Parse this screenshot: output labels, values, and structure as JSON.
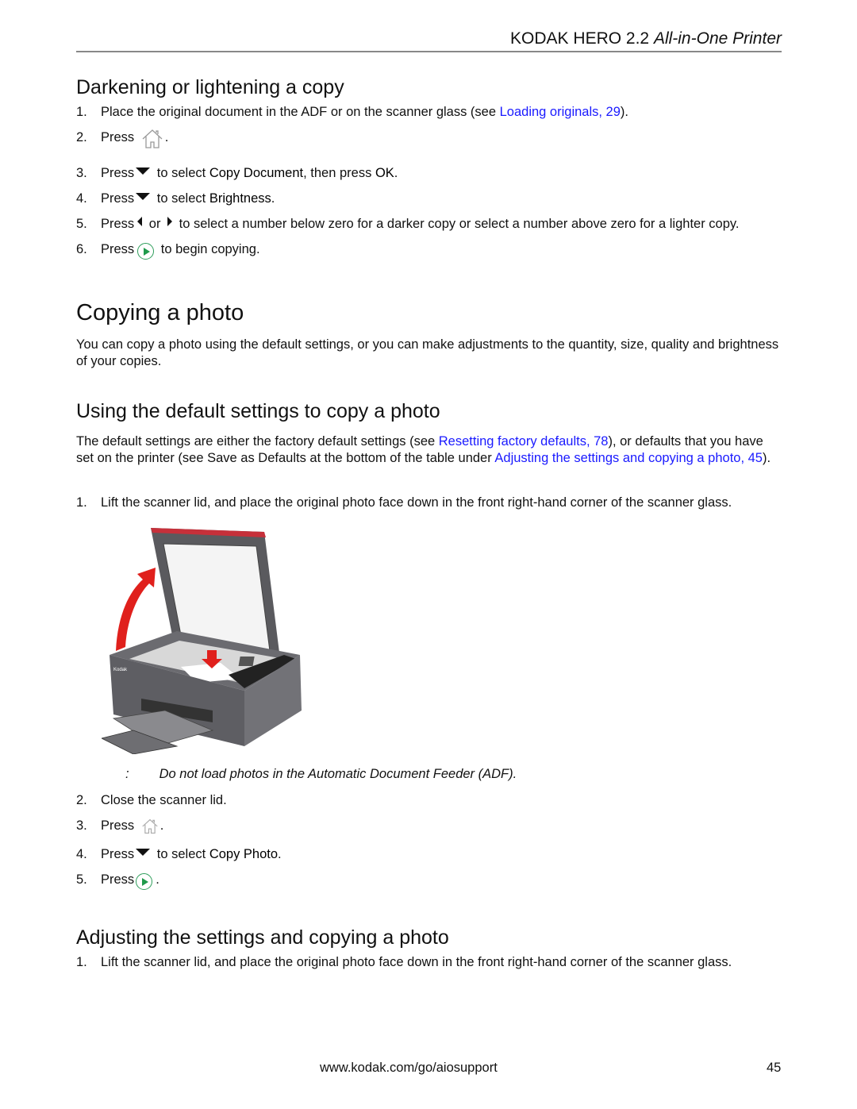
{
  "header": {
    "title_plain": "KODAK HERO 2.2 ",
    "title_italic": "All-in-One Printer"
  },
  "section1": {
    "heading": "Darkening or lightening a copy",
    "steps": [
      {
        "num": "1.",
        "text_a": "Place the original document in the ADF or on the scanner glass (see ",
        "link": "Loading originals, 29",
        "text_b": ")."
      },
      {
        "num": "2.",
        "text_a": "Press",
        "icon": "home-icon",
        "text_b": "."
      },
      {
        "num": "3.",
        "text_a": "Press",
        "icon": "down-arrow-icon",
        "text_b": " to select ",
        "bold": "Copy Document",
        "text_c": ", then press ",
        "bold2": "OK",
        "text_d": "."
      },
      {
        "num": "4.",
        "text_a": "Press",
        "icon": "down-arrow-icon",
        "text_b": " to select ",
        "bold": "Brightness",
        "text_c": "."
      },
      {
        "num": "5.",
        "text_a": "Press",
        "icon": "left-arrow-icon",
        "or": " or ",
        "icon2": "right-arrow-icon",
        "text_b": " to select a number below zero for a darker copy or select a number above zero for a lighter copy."
      },
      {
        "num": "6.",
        "text_a": "Press",
        "icon": "start-icon",
        "text_b": " to begin copying."
      }
    ]
  },
  "section2": {
    "heading": "Copying a photo",
    "intro": "You can copy a photo using the default settings, or you can make adjustments to the quantity, size, quality and brightness of your copies."
  },
  "section3": {
    "heading": "Using the default settings to copy a photo",
    "para_a": "The default settings are either the factory default settings (see ",
    "link1": "Resetting factory defaults, 78",
    "para_b": "), or defaults that you have set on the printer (see Save as Defaults at the bottom of the table under ",
    "link2": "Adjusting the settings and copying a photo, 45",
    "para_c": ").",
    "step1": {
      "num": "1.",
      "text": "Lift the scanner lid, and place the original photo face down in the front right-hand corner of the scanner glass."
    },
    "image_alt": "Printer with open scanner lid and photo on glass",
    "note_colon": ":",
    "note": "Do not load photos in the Automatic Document Feeder (ADF).",
    "steps": [
      {
        "num": "2.",
        "text_a": "Close the scanner lid."
      },
      {
        "num": "3.",
        "text_a": "Press",
        "icon": "home-icon",
        "text_b": "."
      },
      {
        "num": "4.",
        "text_a": "Press",
        "icon": "down-arrow-icon",
        "text_b": " to select ",
        "bold": "Copy Photo",
        "text_c": "."
      },
      {
        "num": "5.",
        "text_a": "Press",
        "icon": "start-icon",
        "text_b": "."
      }
    ]
  },
  "section4": {
    "heading": "Adjusting the settings and copying a photo",
    "step1": {
      "num": "1.",
      "text": "Lift the scanner lid, and place the original photo face down in the front right-hand corner of the scanner glass."
    }
  },
  "footer": {
    "url": "www.kodak.com/go/aiosupport",
    "page": "45"
  }
}
